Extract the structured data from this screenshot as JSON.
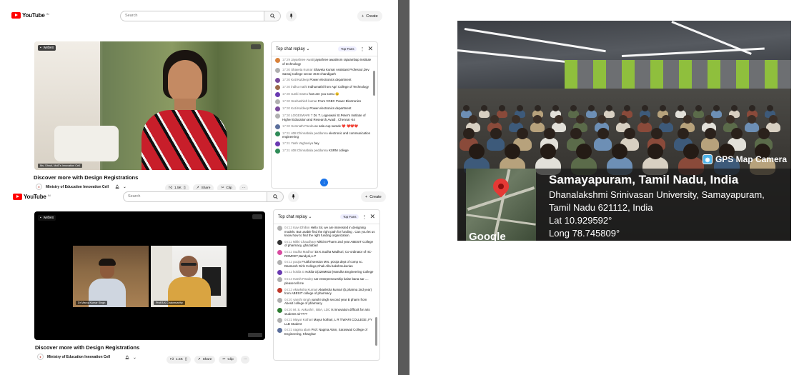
{
  "shot1": {
    "logo": "YouTube",
    "logo_sup": "IN",
    "search_placeholder": "Search",
    "create_label": "Create",
    "video_badge": "webex",
    "name_tag": "Ms. Shruti, MoE's Innovation Cell",
    "title": "Discover more with Design Registrations",
    "channel": "Ministry of Education Innovation Cell",
    "likes": "1.5K",
    "share": "Share",
    "clip": "Clip",
    "chat": {
      "header": "Top chat replay",
      "fans": "Top Fans",
      "messages": [
        {
          "time": "17:29",
          "author": "Jayashree Awati",
          "text": "jayashree awatiirom rajarambap institute of technology",
          "color": "#d9823b"
        },
        {
          "time": "17:30",
          "author": "Shaveta Kumar",
          "text": "Shaveta Kumar Assistant Professor,Dev Samaj College sector 45 B chandigarh",
          "color": "#b0b0b0"
        },
        {
          "time": "17:30",
          "author": "Koti Kuldeep",
          "text": "Power electronics department",
          "color": "#7a4b9c"
        },
        {
          "time": "17:30",
          "author": "indhu mathi",
          "text": "Indhumathi from Agri College of Technology",
          "color": "#9c6b4b"
        },
        {
          "time": "17:30",
          "author": "sunki mamu",
          "text": "how are you somu 😉",
          "color": "#6a3ab2"
        },
        {
          "time": "17:30",
          "author": "Snehashish kumar",
          "text": "From VGEC Power Electronics",
          "color": "#b0b0b0"
        },
        {
          "time": "17:30",
          "author": "Koti Kuldeep",
          "text": "Power electronics department",
          "color": "#7a4b9c"
        },
        {
          "time": "17:30",
          "author": "LOGESWARI T",
          "text": "Dr. T. Logeswari St.Peter's Institute of Higher Education and Research,Avadi , Chennai -54",
          "color": "#b0b0b0"
        },
        {
          "time": "17:30",
          "author": "Somnath Panda",
          "text": "ee sala cup namde ❤️ ❤️❤️❤️",
          "color": "#5b6f9c"
        },
        {
          "time": "17:31",
          "author": "408 Chinnabala peddanna",
          "text": "electronic and communication engineering",
          "color": "#2e8b57"
        },
        {
          "time": "17:31",
          "author": "Yash Vaghasiya",
          "text": "hey",
          "color": "#6a3ab2"
        },
        {
          "time": "17:31",
          "author": "408 Chinnabala peddanna",
          "text": "KSRM college",
          "color": "#2e8b57"
        }
      ]
    }
  },
  "shot2": {
    "logo": "YouTube",
    "logo_sup": "IN",
    "search_placeholder": "Search",
    "create_label": "Create",
    "video_badge": "webex",
    "tag_left": "Dr Manoj Kumar Singh",
    "tag_right": "Prof B.K Chakravarthy",
    "title": "Discover more with Design Registrations",
    "channel": "Ministry of Education Innovation Cell",
    "likes": "1.5K",
    "share": "Share",
    "clip": "Clip",
    "chat": {
      "header": "Top chat replay",
      "fans": "Top Fans",
      "messages": [
        {
          "time": "04:13",
          "author": "Kavi Dhillon",
          "text": "Hello Sir, we are interested in designing models. But unable find the right path for funding . Can you let us know how to find the right funding organization.",
          "color": "#b0b0b0"
        },
        {
          "time": "04:11",
          "author": "Nikki Chaudhary",
          "text": "Nikki B Pharm 2nd year ABESIT College of pharmacy, ghaziabad",
          "color": "#333333"
        },
        {
          "time": "04:11",
          "author": "Sudha Madhuri",
          "text": "Dr.K.Sudha Madhuri, Co-ordinator of IIC-RGMCET,Nandyal,A.P",
          "color": "#d94ba0"
        },
        {
          "time": "04:12",
          "author": "pooja",
          "text": "Fruitful session Mrs. pOoja dept of comp sc. Dasmesh Girls College,Chak Alla bakshmukerian",
          "color": "#b0b0b0"
        },
        {
          "time": "04:12",
          "author": "kokila G",
          "text": "Kokila G(228M032 )Nandha Engineering College",
          "color": "#6a3ab2"
        },
        {
          "time": "04:13",
          "author": "Harsh Pandey",
          "text": "sar enterpreneurship kaise bana sar .... please tell me",
          "color": "#b0b0b0"
        },
        {
          "time": "04:13",
          "author": "Akanksha Kumari",
          "text": "Akanksha kumari (b.pharma 2nd year) from ABESIT college of pharmacy",
          "color": "#c0392b"
        },
        {
          "time": "04:20",
          "author": "yanshi singh",
          "text": "yanshi singh second year B pharm from Abesit college of pharmacy",
          "color": "#b0b0b0"
        },
        {
          "time": "04:20",
          "author": "M. S. Ankushri , BBA, LDC",
          "text": "is innovation difficult for arts students sir????",
          "color": "#2e7d32"
        },
        {
          "time": "04:21",
          "author": "Mayur Kothari",
          "text": "Mayur kothari, L R TIWARI COLLEGE ,FY LLB Student",
          "color": "#b0b0b0"
        },
        {
          "time": "04:21",
          "author": "nagma alam",
          "text": "Prof. Nagma Alam, Saraswati College of Engineering, Kharghar",
          "color": "#5b6f9c"
        }
      ]
    }
  },
  "photo": {
    "badge": "GPS Map Camera",
    "location": "Samayapuram, Tamil Nadu, India",
    "address_line1": "Dhanalakshmi Srinivasan University, Samayapuram,",
    "address_line2": "Tamil Nadu 621112, India",
    "lat": "Lat 10.929592°",
    "long": "Long 78.745809°",
    "map_brand": "Google"
  }
}
